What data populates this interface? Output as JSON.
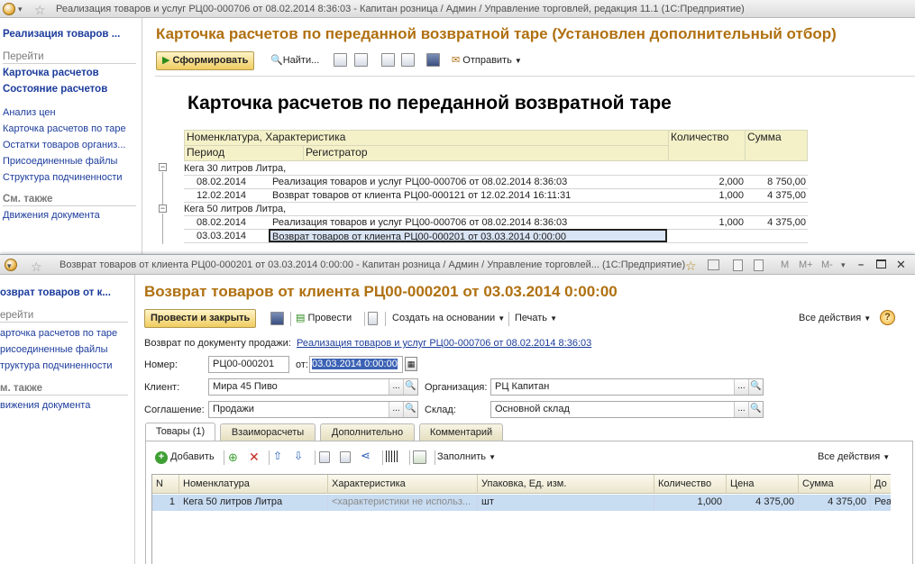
{
  "win1": {
    "title": "Реализация товаров и услуг РЦ00-000706 от 08.02.2014 8:36:03 - Капитан розница / Админ / Управление торговлей, редакция 11.1  (1С:Предприятие)",
    "sidebar": {
      "doc_link": "Реализация товаров ...",
      "goto_head": "Перейти",
      "goto_items": [
        "Карточка расчетов",
        "Состояние расчетов"
      ],
      "other_items": [
        "Анализ цен",
        "Карточка расчетов по таре",
        "Остатки товаров организ...",
        "Присоединенные файлы",
        "Структура подчиненности"
      ],
      "see_also_head": "См. также",
      "see_also_items": [
        "Движения документа"
      ]
    },
    "form_title": "Карточка расчетов по переданной возвратной таре (Установлен дополнительный отбор)",
    "toolbar": {
      "generate": "Сформировать",
      "find": "Найти...",
      "send": "Отправить"
    },
    "report": {
      "title": "Карточка расчетов по переданной возвратной таре",
      "headers": {
        "nomenclature": "Номенклатура, Характеристика",
        "period": "Период",
        "registrar": "Регистратор",
        "quantity": "Количество",
        "sum": "Сумма"
      },
      "groups": [
        {
          "name": "Кега 30 литров Литра,",
          "rows": [
            {
              "period": "08.02.2014",
              "registrar": "Реализация товаров и услуг РЦ00-000706 от 08.02.2014 8:36:03",
              "quantity": "2,000",
              "sum": "8 750,00"
            },
            {
              "period": "12.02.2014",
              "registrar": "Возврат товаров от клиента РЦ00-000121 от 12.02.2014 16:11:31",
              "quantity": "1,000",
              "sum": "4 375,00"
            }
          ]
        },
        {
          "name": "Кега 50 литров Литра,",
          "rows": [
            {
              "period": "08.02.2014",
              "registrar": "Реализация товаров и услуг РЦ00-000706 от 08.02.2014 8:36:03",
              "quantity": "1,000",
              "sum": "4 375,00"
            },
            {
              "period": "03.03.2014",
              "registrar": "Возврат товаров от клиента РЦ00-000201 от 03.03.2014 0:00:00",
              "quantity": "",
              "sum": ""
            }
          ]
        }
      ]
    }
  },
  "win2": {
    "title": "Возврат товаров от клиента РЦ00-000201 от 03.03.2014 0:00:00 - Капитан розница / Админ / Управление торговлей...  (1С:Предприятие)",
    "title_controls": {
      "m": "M",
      "mplus": "M+",
      "mminus": "M-"
    },
    "sidebar": {
      "doc_link": "озврат товаров от к...",
      "goto_head": "ерейти",
      "items": [
        "арточка расчетов по таре",
        "рисоединенные файлы",
        "труктура подчиненности"
      ],
      "see_also_head": "м. также",
      "see_also_items": [
        "вижения документа"
      ]
    },
    "form_title": "Возврат товаров от клиента РЦ00-000201 от 03.03.2014 0:00:00",
    "toolbar": {
      "post_close": "Провести и закрыть",
      "post": "Провести",
      "create_based": "Создать на основании",
      "print": "Печать",
      "all_actions": "Все действия"
    },
    "fields": {
      "sale_doc_label": "Возврат по документу продажи:",
      "sale_doc_link": "Реализация товаров и услуг РЦ00-000706 от 08.02.2014 8:36:03",
      "number_label": "Номер:",
      "number": "РЦ00-000201",
      "from_label": "от:",
      "date": "03.03.2014  0:00:00",
      "client_label": "Клиент:",
      "client": "Мира 45 Пиво",
      "org_label": "Организация:",
      "org": "РЦ Капитан",
      "agreement_label": "Соглашение:",
      "agreement": "Продажи",
      "warehouse_label": "Склад:",
      "warehouse": "Основной склад"
    },
    "tabs": [
      "Товары (1)",
      "Взаиморасчеты",
      "Дополнительно",
      "Комментарий"
    ],
    "table_toolbar": {
      "add": "Добавить",
      "fill": "Заполнить",
      "all_actions": "Все действия"
    },
    "table": {
      "columns": [
        "N",
        "Номенклатура",
        "Характеристика",
        "Упаковка, Ед. изм.",
        "Количество",
        "Цена",
        "Сумма",
        "До"
      ],
      "rows": [
        [
          "1",
          "Кега 50 литров Литра",
          "<характеристики не использ...",
          "шт",
          "1,000",
          "4 375,00",
          "4 375,00",
          "Реа"
        ]
      ]
    }
  }
}
